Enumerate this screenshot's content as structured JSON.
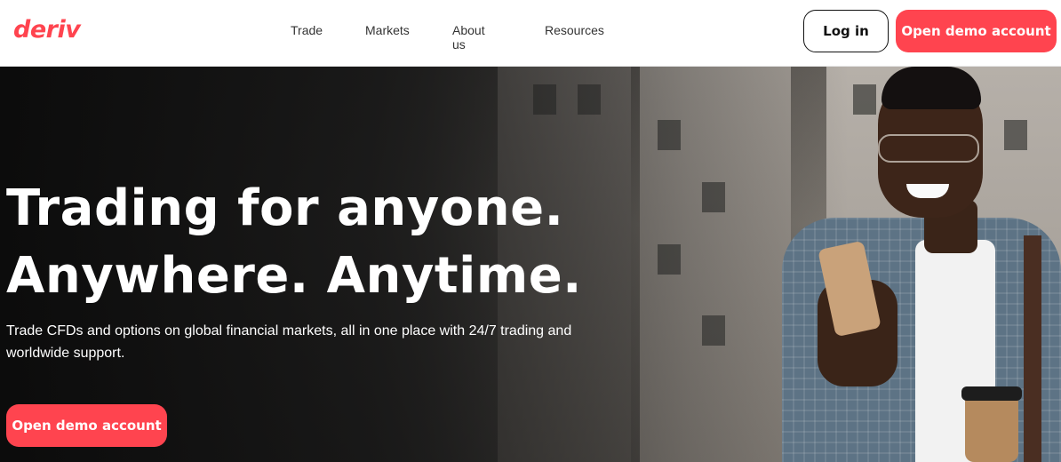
{
  "header": {
    "logo_text": "deriv",
    "nav": [
      {
        "label": "Trade"
      },
      {
        "label": "Markets"
      },
      {
        "label": "About us"
      },
      {
        "label": "Resources"
      }
    ],
    "login_label": "Log in",
    "demo_label": "Open demo account"
  },
  "hero": {
    "title_line1": "Trading for anyone.",
    "title_line2": "Anywhere. Anytime.",
    "subtitle": "Trade CFDs and options on global financial markets, all in one place with 24/7 trading and worldwide support.",
    "cta_label": "Open demo account",
    "image_icon": "man-using-phone-illustration"
  },
  "colors": {
    "brand": "#ff444f",
    "header_bg": "#ffffff",
    "hero_text": "#ffffff"
  }
}
